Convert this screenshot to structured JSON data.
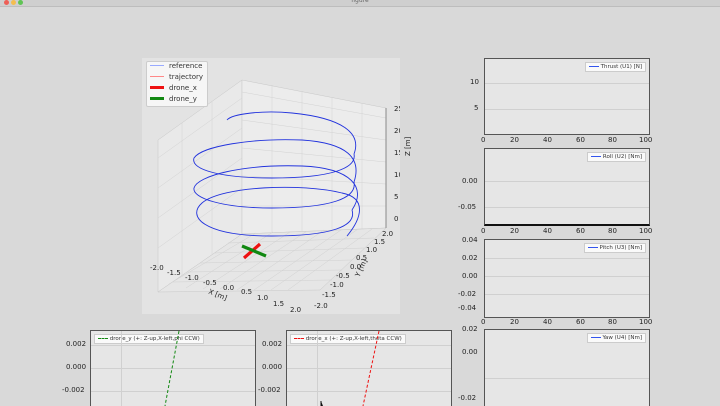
{
  "window": {
    "title": "figure"
  },
  "plot3d": {
    "legend": [
      "reference",
      "trajectory",
      "drone_x",
      "drone_y"
    ],
    "xlabel": "X [m]",
    "ylabel": "Y [m]",
    "zlabel": "Z [m]",
    "x_ticks": [
      "-2.0",
      "-1.5",
      "-1.0",
      "-0.5",
      "0.0",
      "0.5",
      "1.0",
      "1.5",
      "2.0"
    ],
    "y_ticks": [
      "-2.0",
      "-1.5",
      "-1.0",
      "-0.5",
      "0.0",
      "0.5",
      "1.0",
      "1.5",
      "2.0"
    ],
    "z_ticks": [
      "0",
      "5",
      "10",
      "15",
      "20",
      "25"
    ]
  },
  "subplots": {
    "thrust": {
      "legend": "Thrust (U1) [N]",
      "y_ticks": [
        "10",
        "5"
      ],
      "x_ticks": [
        "0",
        "20",
        "40",
        "60",
        "80",
        "100"
      ]
    },
    "roll": {
      "legend": "Roll (U2) [Nm]",
      "y_ticks": [
        "0.00",
        "-0.05"
      ],
      "x_ticks": [
        "0",
        "20",
        "40",
        "60",
        "80",
        "100"
      ]
    },
    "pitch": {
      "legend": "Pitch (U3) [Nm]",
      "y_ticks": [
        "0.04",
        "0.02",
        "0.00",
        "-0.02",
        "-0.04"
      ],
      "x_ticks": [
        "0",
        "20",
        "40",
        "60",
        "80",
        "100"
      ]
    },
    "yaw": {
      "legend": "Yaw (U4) [Nm]",
      "y_ticks": [
        "0.02",
        "0.00",
        "-0.02"
      ]
    }
  },
  "bottom_left": {
    "legend": "drone_y (+: Z-up,X-left,phi CCW)",
    "y_ticks": [
      "0.002",
      "0.000",
      "-0.002"
    ]
  },
  "bottom_mid": {
    "legend": "drone_x (+: Z-up,X-left,theta CCW)",
    "y_ticks": [
      "0.002",
      "0.000",
      "-0.002"
    ]
  },
  "colors": {
    "reference": "#2233dd",
    "trajectory": "#ff6666",
    "drone_x": "#ee1111",
    "drone_y": "#118811"
  }
}
